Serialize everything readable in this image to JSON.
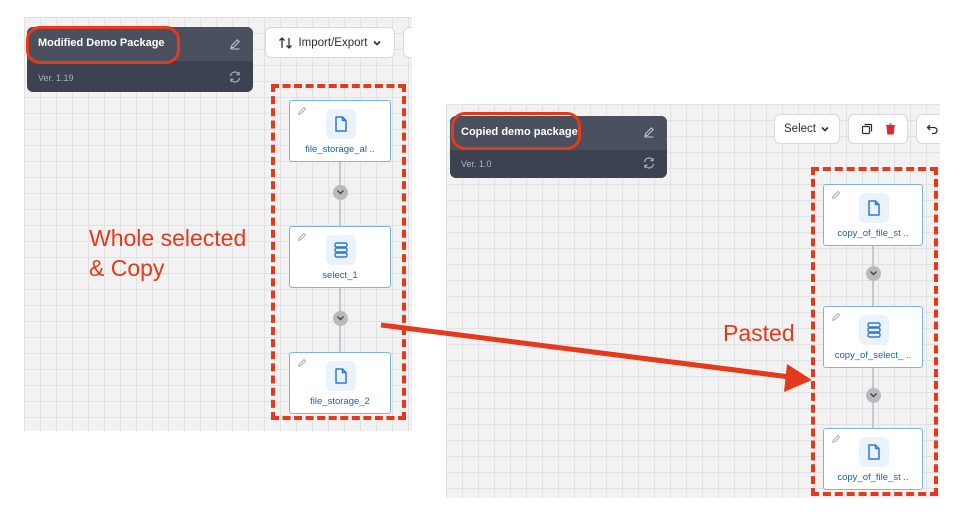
{
  "left": {
    "package_title": "Modified Demo Package",
    "version": "Ver. 1.19",
    "import_export_label": "Import/Export",
    "nodes": [
      {
        "label": "file_storage_al ..",
        "icon": "file-icon"
      },
      {
        "label": "select_1",
        "icon": "select-icon"
      },
      {
        "label": "file_storage_2",
        "icon": "file-icon"
      }
    ]
  },
  "right": {
    "package_title": "Copied demo package",
    "version": "Ver. 1.0",
    "select_label": "Select",
    "nodes": [
      {
        "label": "copy_of_file_st ..",
        "icon": "file-icon"
      },
      {
        "label": "copy_of_select_ ..",
        "icon": "select-icon"
      },
      {
        "label": "copy_of_file_st ..",
        "icon": "file-icon"
      }
    ]
  },
  "annotations": {
    "selected_line1": "Whole selected",
    "selected_line2": "& Copy",
    "pasted": "Pasted"
  },
  "colors": {
    "annotation": "#e5391b",
    "package_card": "#3c4250",
    "node_border": "#7fb3e6",
    "node_text": "#1f5fa8"
  }
}
